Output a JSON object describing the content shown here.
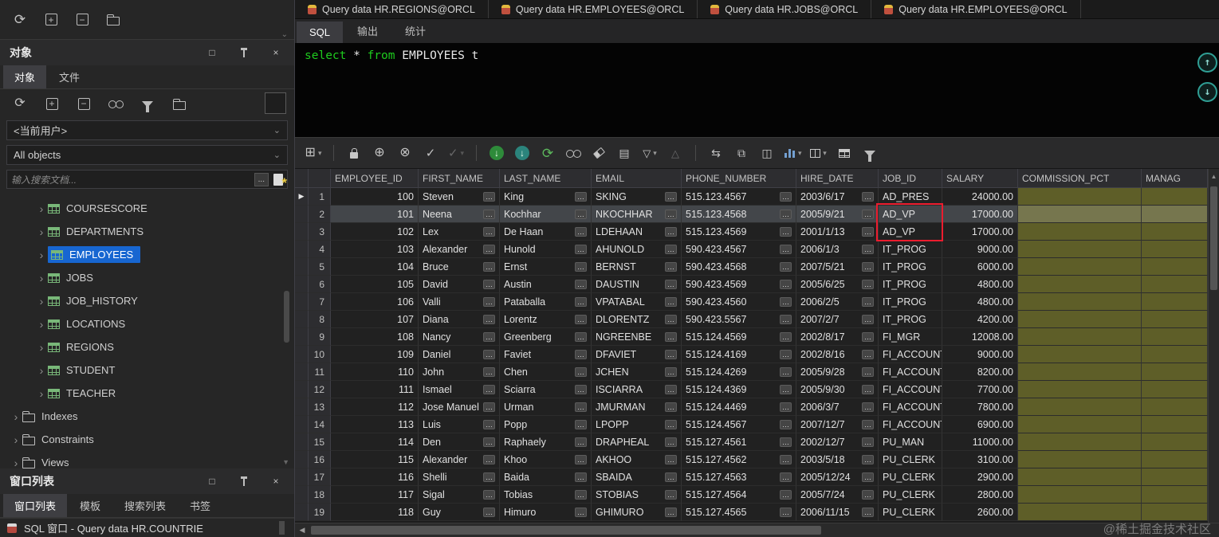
{
  "icons": {
    "restore": "□",
    "close": "×",
    "caret_down": "⌄",
    "chevron_right": "›",
    "dropdown_arrow": "▾",
    "row_marker": "▶",
    "cell_expand": "…",
    "nav_up": "↑",
    "nav_down": "↓",
    "scroll_up": "▲",
    "scroll_down": "▼",
    "scroll_left": "◀"
  },
  "doc_tabs": [
    {
      "label": "Query data HR.REGIONS@ORCL"
    },
    {
      "label": "Query data HR.EMPLOYEES@ORCL"
    },
    {
      "label": "Query data HR.JOBS@ORCL"
    },
    {
      "label": "Query data HR.EMPLOYEES@ORCL"
    }
  ],
  "editor": {
    "tabs": [
      {
        "label": "SQL",
        "active": true
      },
      {
        "label": "输出",
        "active": false
      },
      {
        "label": "统计",
        "active": false
      }
    ],
    "sql_tokens": [
      {
        "text": "select ",
        "type": "keyword"
      },
      {
        "text": "* ",
        "type": "plain"
      },
      {
        "text": "from ",
        "type": "keyword"
      },
      {
        "text": "EMPLOYEES t",
        "type": "plain"
      }
    ]
  },
  "sidebar": {
    "top_toolbar": [
      {
        "name": "refresh",
        "glyph": "⟳",
        "size": 17
      },
      {
        "name": "add",
        "css": "box",
        "glyph": "+"
      },
      {
        "name": "remove",
        "css": "box",
        "glyph": "−"
      },
      {
        "name": "open-folder",
        "css": "folder"
      }
    ],
    "objects_panel_title": "对象",
    "panel_tabs": [
      {
        "label": "对象",
        "active": true
      },
      {
        "label": "文件",
        "active": false
      }
    ],
    "objects_toolbar": [
      {
        "name": "refresh",
        "glyph": "⟳",
        "size": 16
      },
      {
        "name": "add",
        "css": "box",
        "glyph": "+"
      },
      {
        "name": "remove",
        "css": "box",
        "glyph": "−"
      },
      {
        "name": "find",
        "css": "binoc"
      },
      {
        "name": "filter",
        "css": "funnel"
      },
      {
        "name": "open-folder",
        "css": "folder"
      }
    ],
    "current_user_dropdown": "<当前用户>",
    "object_filter_dropdown": "All objects",
    "search_placeholder": "输入搜索文档...",
    "search_more": "...",
    "tree": {
      "tables": [
        {
          "label": "COURSESCORE",
          "selected": false
        },
        {
          "label": "DEPARTMENTS",
          "selected": false
        },
        {
          "label": "EMPLOYEES",
          "selected": true
        },
        {
          "label": "JOBS",
          "selected": false
        },
        {
          "label": "JOB_HISTORY",
          "selected": false
        },
        {
          "label": "LOCATIONS",
          "selected": false
        },
        {
          "label": "REGIONS",
          "selected": false
        },
        {
          "label": "STUDENT",
          "selected": false
        },
        {
          "label": "TEACHER",
          "selected": false
        }
      ],
      "folders": [
        {
          "label": "Indexes"
        },
        {
          "label": "Constraints"
        },
        {
          "label": "Views"
        }
      ]
    },
    "window_list_panel_title": "窗口列表",
    "window_list_tabs": [
      {
        "label": "窗口列表",
        "active": true
      },
      {
        "label": "模板",
        "active": false
      },
      {
        "label": "搜索列表",
        "active": false
      },
      {
        "label": "书签",
        "active": false
      }
    ],
    "window_list_item": "SQL 窗口 - Query data HR.COUNTRIE"
  },
  "grid": {
    "toolbar": [
      {
        "name": "pin-grid",
        "glyph": "⊞",
        "size": 16,
        "dropdown": true
      },
      {
        "name": "sep"
      },
      {
        "name": "lock",
        "css": "lock"
      },
      {
        "name": "insert-record",
        "glyph": "⊕",
        "size": 16
      },
      {
        "name": "delete-record",
        "glyph": "⊗",
        "size": 16
      },
      {
        "name": "post-changes",
        "glyph": "✓",
        "size": 15
      },
      {
        "name": "commit",
        "glyph": "✓",
        "size": 15,
        "dim": true,
        "dropdown": true
      },
      {
        "name": "sep"
      },
      {
        "name": "fetch-next",
        "glyph": "↓",
        "css": "circg"
      },
      {
        "name": "fetch-all",
        "glyph": "↓",
        "css": "circt"
      },
      {
        "name": "refresh-query",
        "glyph": "⟳",
        "size": 17,
        "color": "#5cb85c"
      },
      {
        "name": "find",
        "css": "binoc"
      },
      {
        "name": "erase",
        "css": "eraser"
      },
      {
        "name": "single-record",
        "glyph": "▤",
        "size": 14
      },
      {
        "name": "filter",
        "glyph": "▽",
        "size": 13,
        "dropdown": true
      },
      {
        "name": "sort",
        "glyph": "△",
        "size": 13,
        "dim": true
      },
      {
        "name": "sep"
      },
      {
        "name": "link-windows",
        "glyph": "⇆",
        "size": 14
      },
      {
        "name": "duplicate-window",
        "glyph": "⧉",
        "size": 14
      },
      {
        "name": "form-view",
        "glyph": "◫",
        "size": 14
      },
      {
        "name": "chart",
        "css": "chart",
        "dropdown": true
      },
      {
        "name": "column-layout",
        "css": "cols",
        "dropdown": true
      },
      {
        "name": "grid-view",
        "css": "tblg"
      },
      {
        "name": "funnel",
        "css": "funnel"
      }
    ],
    "columns": [
      "EMPLOYEE_ID",
      "FIRST_NAME",
      "LAST_NAME",
      "EMAIL",
      "PHONE_NUMBER",
      "HIRE_DATE",
      "JOB_ID",
      "SALARY",
      "COMMISSION_PCT",
      "MANAG"
    ],
    "rows": [
      {
        "n": 1,
        "employee_id": "100",
        "first_name": "Steven",
        "last_name": "King",
        "email": "SKING",
        "phone": "515.123.4567",
        "hire_date": "2003/6/17",
        "job_id": "AD_PRES",
        "salary": "24000.00"
      },
      {
        "n": 2,
        "employee_id": "101",
        "first_name": "Neena",
        "last_name": "Kochhar",
        "email": "NKOCHHAR",
        "phone": "515.123.4568",
        "hire_date": "2005/9/21",
        "job_id": "AD_VP",
        "salary": "17000.00"
      },
      {
        "n": 3,
        "employee_id": "102",
        "first_name": "Lex",
        "last_name": "De Haan",
        "email": "LDEHAAN",
        "phone": "515.123.4569",
        "hire_date": "2001/1/13",
        "job_id": "AD_VP",
        "salary": "17000.00"
      },
      {
        "n": 4,
        "employee_id": "103",
        "first_name": "Alexander",
        "last_name": "Hunold",
        "email": "AHUNOLD",
        "phone": "590.423.4567",
        "hire_date": "2006/1/3",
        "job_id": "IT_PROG",
        "salary": "9000.00"
      },
      {
        "n": 5,
        "employee_id": "104",
        "first_name": "Bruce",
        "last_name": "Ernst",
        "email": "BERNST",
        "phone": "590.423.4568",
        "hire_date": "2007/5/21",
        "job_id": "IT_PROG",
        "salary": "6000.00"
      },
      {
        "n": 6,
        "employee_id": "105",
        "first_name": "David",
        "last_name": "Austin",
        "email": "DAUSTIN",
        "phone": "590.423.4569",
        "hire_date": "2005/6/25",
        "job_id": "IT_PROG",
        "salary": "4800.00"
      },
      {
        "n": 7,
        "employee_id": "106",
        "first_name": "Valli",
        "last_name": "Pataballa",
        "email": "VPATABAL",
        "phone": "590.423.4560",
        "hire_date": "2006/2/5",
        "job_id": "IT_PROG",
        "salary": "4800.00"
      },
      {
        "n": 8,
        "employee_id": "107",
        "first_name": "Diana",
        "last_name": "Lorentz",
        "email": "DLORENTZ",
        "phone": "590.423.5567",
        "hire_date": "2007/2/7",
        "job_id": "IT_PROG",
        "salary": "4200.00"
      },
      {
        "n": 9,
        "employee_id": "108",
        "first_name": "Nancy",
        "last_name": "Greenberg",
        "email": "NGREENBE",
        "phone": "515.124.4569",
        "hire_date": "2002/8/17",
        "job_id": "FI_MGR",
        "salary": "12008.00"
      },
      {
        "n": 10,
        "employee_id": "109",
        "first_name": "Daniel",
        "last_name": "Faviet",
        "email": "DFAVIET",
        "phone": "515.124.4169",
        "hire_date": "2002/8/16",
        "job_id": "FI_ACCOUNT",
        "salary": "9000.00"
      },
      {
        "n": 11,
        "employee_id": "110",
        "first_name": "John",
        "last_name": "Chen",
        "email": "JCHEN",
        "phone": "515.124.4269",
        "hire_date": "2005/9/28",
        "job_id": "FI_ACCOUNT",
        "salary": "8200.00"
      },
      {
        "n": 12,
        "employee_id": "111",
        "first_name": "Ismael",
        "last_name": "Sciarra",
        "email": "ISCIARRA",
        "phone": "515.124.4369",
        "hire_date": "2005/9/30",
        "job_id": "FI_ACCOUNT",
        "salary": "7700.00"
      },
      {
        "n": 13,
        "employee_id": "112",
        "first_name": "Jose Manuel",
        "last_name": "Urman",
        "email": "JMURMAN",
        "phone": "515.124.4469",
        "hire_date": "2006/3/7",
        "job_id": "FI_ACCOUNT",
        "salary": "7800.00"
      },
      {
        "n": 14,
        "employee_id": "113",
        "first_name": "Luis",
        "last_name": "Popp",
        "email": "LPOPP",
        "phone": "515.124.4567",
        "hire_date": "2007/12/7",
        "job_id": "FI_ACCOUNT",
        "salary": "6900.00"
      },
      {
        "n": 15,
        "employee_id": "114",
        "first_name": "Den",
        "last_name": "Raphaely",
        "email": "DRAPHEAL",
        "phone": "515.127.4561",
        "hire_date": "2002/12/7",
        "job_id": "PU_MAN",
        "salary": "11000.00"
      },
      {
        "n": 16,
        "employee_id": "115",
        "first_name": "Alexander",
        "last_name": "Khoo",
        "email": "AKHOO",
        "phone": "515.127.4562",
        "hire_date": "2003/5/18",
        "job_id": "PU_CLERK",
        "salary": "3100.00"
      },
      {
        "n": 17,
        "employee_id": "116",
        "first_name": "Shelli",
        "last_name": "Baida",
        "email": "SBAIDA",
        "phone": "515.127.4563",
        "hire_date": "2005/12/24",
        "job_id": "PU_CLERK",
        "salary": "2900.00"
      },
      {
        "n": 18,
        "employee_id": "117",
        "first_name": "Sigal",
        "last_name": "Tobias",
        "email": "STOBIAS",
        "phone": "515.127.4564",
        "hire_date": "2005/7/24",
        "job_id": "PU_CLERK",
        "salary": "2800.00"
      },
      {
        "n": 19,
        "employee_id": "118",
        "first_name": "Guy",
        "last_name": "Himuro",
        "email": "GHIMURO",
        "phone": "515.127.4565",
        "hire_date": "2006/11/15",
        "job_id": "PU_CLERK",
        "salary": "2600.00"
      }
    ],
    "highlight": {
      "rows": [
        2,
        3
      ],
      "column": "JOB_ID",
      "color": "#ec1c2e"
    },
    "selected_row": 2,
    "current_row": 1
  },
  "watermark": "@稀土掘金技术社区",
  "colors": {
    "accent_blue": "#1766d1",
    "keyword_green": "#1ecb1e",
    "null_cell_olive": "#5e5e28",
    "highlight_red": "#ec1c2e"
  }
}
